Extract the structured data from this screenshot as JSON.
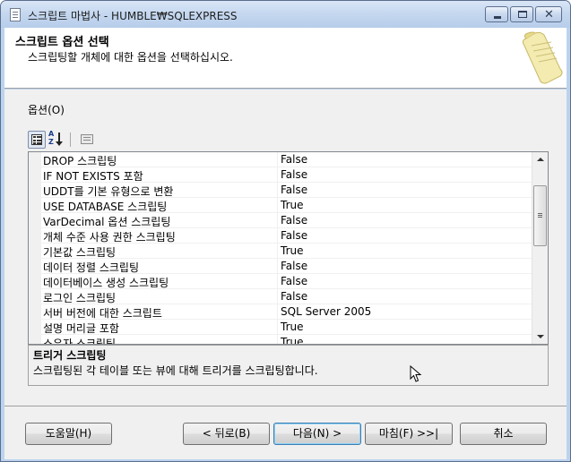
{
  "window": {
    "title": "스크립트 마법사 - HUMBLE₩SQLEXPRESS"
  },
  "header": {
    "title": "스크립트 옵션 선택",
    "subtitle": "스크립팅할 개체에 대한 옵션을 선택하십시오."
  },
  "options": {
    "label": "옵션(O)",
    "rows": [
      {
        "name": "DROP 스크립팅",
        "value": "False"
      },
      {
        "name": "IF NOT EXISTS 포함",
        "value": "False"
      },
      {
        "name": "UDDT를 기본 유형으로 변환",
        "value": "False"
      },
      {
        "name": "USE DATABASE 스크립팅",
        "value": "True"
      },
      {
        "name": "VarDecimal 옵션 스크립팅",
        "value": "False"
      },
      {
        "name": "개체 수준 사용 권한 스크립팅",
        "value": "False"
      },
      {
        "name": "기본값 스크립팅",
        "value": "True"
      },
      {
        "name": "데이터 정렬 스크립팅",
        "value": "False"
      },
      {
        "name": "데이터베이스 생성 스크립팅",
        "value": "False"
      },
      {
        "name": "로그인 스크립팅",
        "value": "False"
      },
      {
        "name": "서버 버전에 대한 스크립트",
        "value": "SQL Server 2005"
      },
      {
        "name": "설명 머리글 포함",
        "value": "True"
      },
      {
        "name": "소유자 스크립팅",
        "value": "True"
      }
    ]
  },
  "description": {
    "title": "트리거 스크립팅",
    "text": "스크립팅된 각 테이블 또는 뷰에 대해 트리거를 스크립팅합니다."
  },
  "buttons": {
    "help": "도움말(H)",
    "back": "< 뒤로(B)",
    "next": "다음(N) >",
    "finish": "마침(F) >>|",
    "cancel": "취소"
  }
}
